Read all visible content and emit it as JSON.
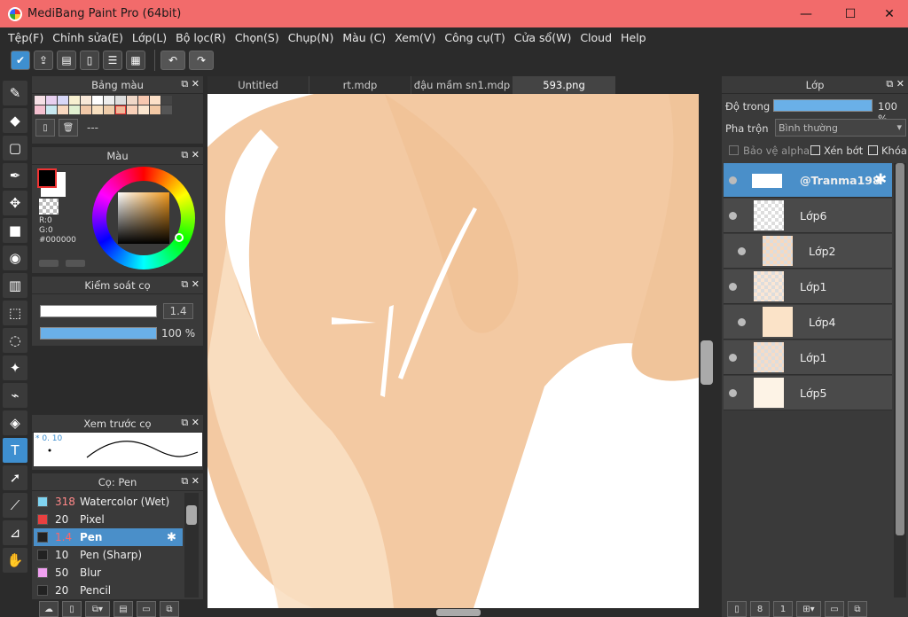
{
  "window": {
    "title": "MediBang Paint Pro (64bit)",
    "min": "—",
    "max": "☐",
    "close": "✕"
  },
  "menu": [
    "Tệp(F)",
    "Chỉnh sửa(E)",
    "Lớp(L)",
    "Bộ lọc(R)",
    "Chọn(S)",
    "Chụp(N)",
    "Màu (C)",
    "Xem(V)",
    "Công cụ(T)",
    "Cửa sổ(W)",
    "Cloud",
    "Help"
  ],
  "tabs": [
    "Untitled",
    "rt.mdp",
    "đậu mầm sn1.mdp",
    "593.png"
  ],
  "palette": {
    "title": "Bảng màu",
    "name": "---"
  },
  "color": {
    "title": "Màu",
    "r": "R:0",
    "g": "G:0",
    "hex": "#000000"
  },
  "brush_control": {
    "title": "Kiểm soát cọ",
    "size": "1.4",
    "opacity": "100 %"
  },
  "brush_preview": {
    "title": "Xem trước cọ",
    "size": "* 0. 10"
  },
  "brush_list": {
    "title": "Cọ: Pen",
    "items": [
      {
        "size": "318",
        "name": "Watercolor (Wet)",
        "color": "#7fd3f0"
      },
      {
        "size": "20",
        "name": "Pixel",
        "color": "#e84040"
      },
      {
        "size": "1.4",
        "name": "Pen",
        "color": "#222222"
      },
      {
        "size": "10",
        "name": "Pen (Sharp)",
        "color": "#222222"
      },
      {
        "size": "50",
        "name": "Blur",
        "color": "#f0a0f0"
      },
      {
        "size": "20",
        "name": "Pencil",
        "color": "#222222"
      }
    ]
  },
  "layer_panel": {
    "title": "Lớp",
    "opacity_label": "Độ trong",
    "opacity_value": "100 %",
    "blend_label": "Pha trộn",
    "blend_value": "Bình thường",
    "protect_alpha": "Bảo vệ alpha",
    "clip": "Xén bớt",
    "lock": "Khóa",
    "layers": [
      {
        "name": "@Tranma198",
        "selected": true,
        "indent": false
      },
      {
        "name": "Lớp6",
        "selected": false,
        "indent": false
      },
      {
        "name": "Lớp2",
        "selected": false,
        "indent": true
      },
      {
        "name": "Lớp1",
        "selected": false,
        "indent": false
      },
      {
        "name": "Lớp4",
        "selected": false,
        "indent": true
      },
      {
        "name": "Lớp1",
        "selected": false,
        "indent": false
      },
      {
        "name": "Lớp5",
        "selected": false,
        "indent": false
      }
    ]
  },
  "colors": {
    "accent": "#4a8fc9",
    "titlebar": "#f26b6b",
    "skin": "#f3c9a2"
  }
}
